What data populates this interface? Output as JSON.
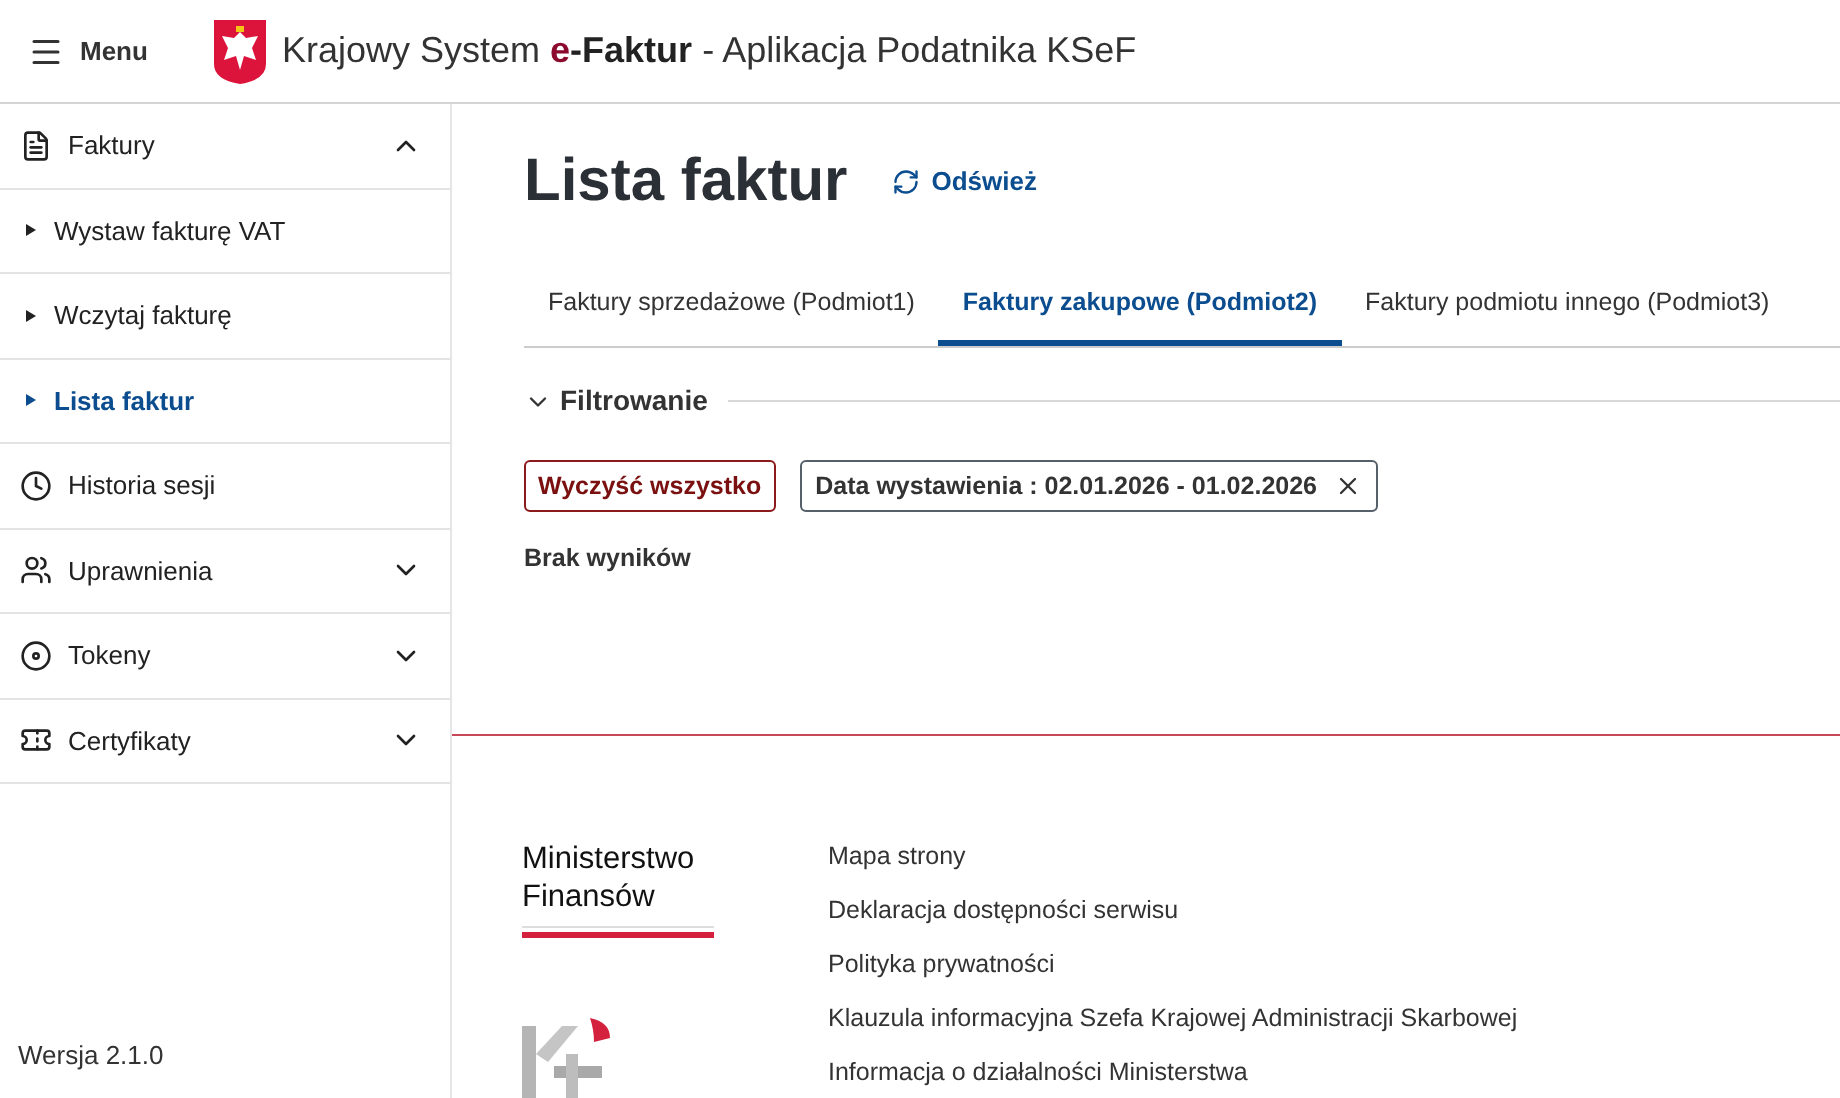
{
  "header": {
    "menu_label": "Menu",
    "title_start": "Krajowy System",
    "title_brand": "e-Faktur",
    "title_end": "- Aplikacja Podatnika KSeF"
  },
  "sidebar": {
    "items": [
      {
        "label": "Faktury",
        "expanded": true,
        "children": [
          {
            "label": "Wystaw fakturę VAT",
            "selected": false
          },
          {
            "label": "Wczytaj fakturę",
            "selected": false
          },
          {
            "label": "Lista faktur",
            "selected": true
          }
        ]
      },
      {
        "label": "Historia sesji"
      },
      {
        "label": "Uprawnienia",
        "expanded": false
      },
      {
        "label": "Tokeny",
        "expanded": false
      },
      {
        "label": "Certyfikaty",
        "expanded": false
      }
    ],
    "version": "Wersja 2.1.0"
  },
  "page": {
    "title": "Lista faktur",
    "refresh_label": "Odśwież"
  },
  "tabs": [
    {
      "label": "Faktury sprzedażowe (Podmiot1)",
      "selected": false
    },
    {
      "label": "Faktury zakupowe (Podmiot2)",
      "selected": true
    },
    {
      "label": "Faktury podmiotu innego (Podmiot3)",
      "selected": false
    }
  ],
  "filters": {
    "title": "Filtrowanie",
    "expanded": true,
    "clear_label": "Wyczyść wszystko",
    "chips": [
      "Data wystawienia : 02.01.2026 - 01.02.2026"
    ]
  },
  "results": {
    "message": "Brak wyników"
  },
  "footer": {
    "ministry_line1": "Ministerstwo",
    "ministry_line2": "Finansów",
    "links": [
      "Mapa strony",
      "Deklaracja dostępności serwisu",
      "Polityka prywatności",
      "Klauzula informacyjna Szefa Krajowej Administracji Skarbowej",
      "Informacja o działalności Ministerstwa"
    ]
  }
}
